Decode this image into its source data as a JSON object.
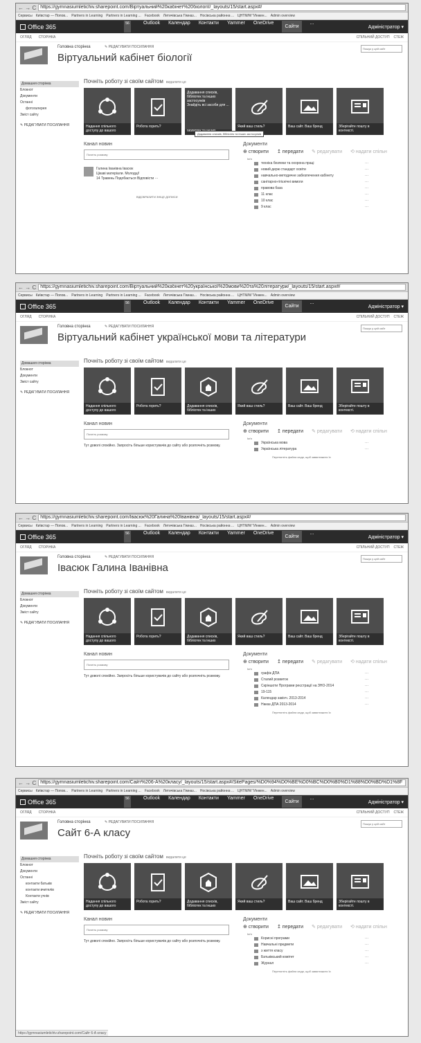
{
  "browser": {
    "nav": "← → C",
    "bookmarks": [
      "Сервисы",
      "Київстар — Попов...",
      "Partners in Learning",
      "Partners in Learning ...",
      "Facebook",
      "Летичівська Гімназ...",
      "Носівська районна ...",
      "ЦНТМ/М \"Инжен...",
      "Admin overview"
    ]
  },
  "suite": {
    "brand": "Office 365",
    "apps": [
      "Outlook",
      "Календар",
      "Контакти",
      "Yammer",
      "OneDrive",
      "Сайти",
      "..."
    ],
    "admin": "Адміністратор ▾",
    "badge": "56"
  },
  "subbar": {
    "left": [
      "ОГЛЯД",
      "СТОРІНКА"
    ],
    "share": "СПІЛЬНИЙ ДОСТУП",
    "follow": "СТЕЖ"
  },
  "common": {
    "home_crumb": "Головна сторінка",
    "edit_links": "✎ РЕДАГУВАТИ ПОСИЛАННЯ",
    "search": "Пошук у цей сайт",
    "getting_started": "Почніть роботу зі своїм сайтом",
    "remove": "видалити це",
    "news_title": "Канал новин",
    "news_placeholder": "Почніть розмову",
    "docs_title": "Документи",
    "new": "⊕ створити",
    "upload": "↥ передати",
    "edit": "✎ редагувати",
    "share": "⟲ надати спільн",
    "name_col": "Ім'я",
    "drag": "Перетягніть файли сюди, щоб завантажити їх",
    "edit_nav": "✎ РЕДАГУВАТИ ПОСИЛАННЯ",
    "quiet": "Тут доволі спокійно. Запросіть більше користувачів до сайту або розпочніть розмову."
  },
  "tiles": [
    "Надання спільного доступу до вашого",
    "Робота горить?",
    "Додавання списків, бібліотек та інших",
    "Який ваш стиль?",
    "Ваш сайт. Ваш бренд",
    "Зберігайте пошту в контексті."
  ],
  "sites": [
    {
      "url": "https://gymnasiumletichiv.sharepoint.com/Віртуальний%20кабінет%20біології/_layouts/15/start.aspx#/",
      "title": "Віртуальний кабінет біології",
      "nav": [
        "Домашня сторінка",
        "Блокнот",
        "Документи",
        "Останні",
        "фотогалерея",
        "Зміст сайту"
      ],
      "popup": "Додавання списків, бібліотек та інших застосунків\nЗнайдіть всі засоби для ...",
      "tooltip": "Додавання списків, бібліотек та інших застосунків",
      "post": {
        "author": "Галина Іванівна Івасюк",
        "text": "Цікаві матеріали. Молодці!",
        "meta": "14 Травень  Подобається  Відповісти  ···"
      },
      "older": "ВІДОБРАЗИТИ ЗНІЦЕ ДОПИСИ",
      "docs": [
        "техніка безпеки та охорона праці",
        "новий держ стандарт освіти",
        "навчально-методичне забезпечення кабінету",
        "санітарно-гігієнічні вимоги",
        "правова база",
        "11 клас",
        "10 клас",
        "9 клас"
      ]
    },
    {
      "url": "https://gymnasiumletichiv.sharepoint.com/Віртуальний%20кабінет%20української%20мови%20та%20літератури/_layouts/15/start.aspx#/",
      "title": "Віртуальний кабінет української мови та літератури",
      "nav": [
        "Домашня сторінка",
        "Блокнот",
        "Документи",
        "Зміст сайту"
      ],
      "docs": [
        "Українська мова",
        "Українська література"
      ]
    },
    {
      "url": "https://gymnasiumletichiv.sharepoint.com/Івасюк%20Галина%20Іванівна/_layouts/15/start.aspx#/",
      "title": "Івасюк Галина Іванівна",
      "nav": [
        "Домашня сторінка",
        "Блокнот",
        "Документи",
        "Зміст сайту"
      ],
      "docs": [
        "графік ДПА",
        "Сталий розвиток",
        "Скріншоти Програми реєстрації на ЗНО-2014",
        "19-115",
        "Календар закінч. 2013-2014",
        "Наказ ДПА 2013-2014"
      ]
    },
    {
      "url": "https://gymnasiumletichiv.sharepoint.com/Сайт%206-А%20класу/_layouts/15/start.aspx#/SitePages/%D0%94%D0%BE%D0%BC%D0%B0%D1%88%D0%BD%D1%8F",
      "title": "Сайт 6-А класу",
      "nav": [
        "Домашня сторінка",
        "Блокнот",
        "Документи",
        "Останні",
        "контакти батьків",
        "контакти вчителів",
        "Контакти учнів",
        "Зміст сайту"
      ],
      "docs": [
        "Корисні програми",
        "Навчальні предмети",
        "з життя класу",
        "Батьківський комітет",
        "Журнал"
      ],
      "status": "https://gymnasiumletichiv.sharepoint.com/Сайт 6-А класу"
    }
  ]
}
